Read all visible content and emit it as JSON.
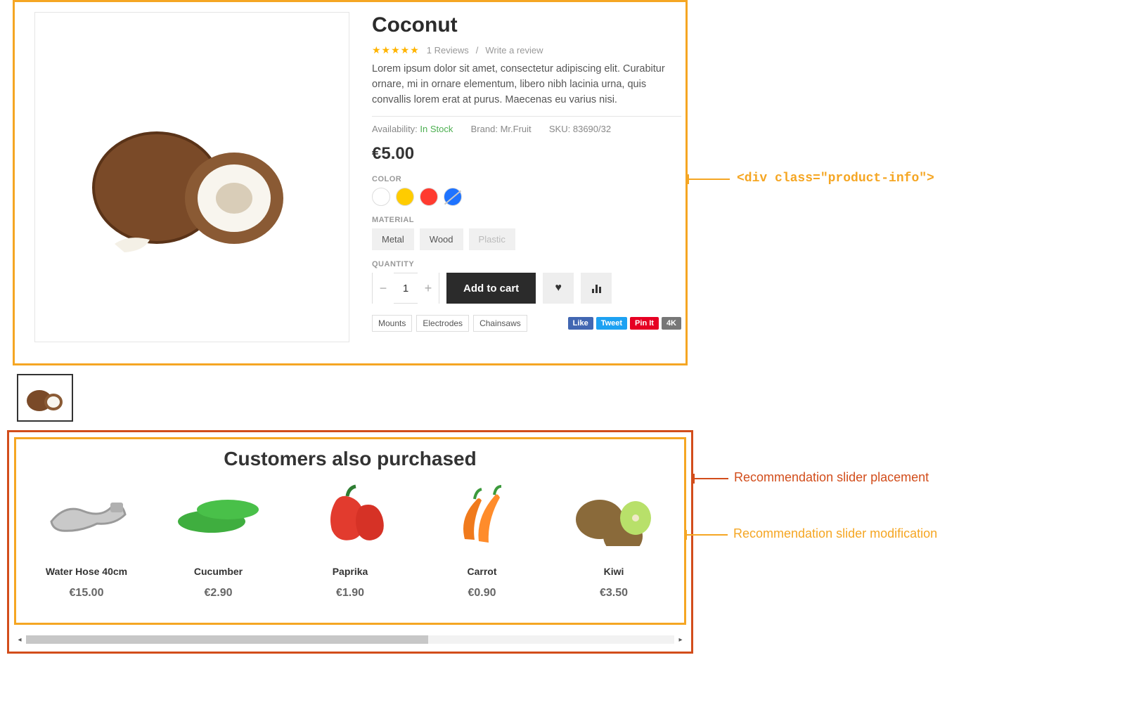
{
  "product": {
    "title": "Coconut",
    "reviews_count": "1 Reviews",
    "write_review": "Write a review",
    "description": "Lorem ipsum dolor sit amet, consectetur adipiscing elit. Curabitur ornare, mi in ornare elementum, libero nibh lacinia urna, quis convallis lorem erat at purus. Maecenas eu varius nisi.",
    "availability_label": "Availability:",
    "availability_value": "In Stock",
    "brand_label": "Brand:",
    "brand_value": "Mr.Fruit",
    "sku_label": "SKU:",
    "sku_value": "83690/32",
    "price": "€5.00",
    "color_label": "COLOR",
    "colors": [
      {
        "hex": "#ffffff",
        "disabled": false
      },
      {
        "hex": "#ffcc00",
        "disabled": false
      },
      {
        "hex": "#ff3b30",
        "disabled": false
      },
      {
        "hex": "#1e73ff",
        "disabled": true
      }
    ],
    "material_label": "MATERIAL",
    "materials": [
      {
        "label": "Metal",
        "disabled": false
      },
      {
        "label": "Wood",
        "disabled": false
      },
      {
        "label": "Plastic",
        "disabled": true
      }
    ],
    "quantity_label": "QUANTITY",
    "quantity_value": "1",
    "add_to_cart": "Add to cart",
    "tags": [
      "Mounts",
      "Electrodes",
      "Chainsaws"
    ],
    "social": {
      "like": "Like",
      "tweet": "Tweet",
      "pin": "Pin It",
      "count": "4K"
    }
  },
  "annotations": {
    "product_info": "<div class=\"product-info\">",
    "slider_placement": "Recommendation slider placement",
    "slider_modification": "Recommendation slider modification"
  },
  "recommendations": {
    "title": "Customers also purchased",
    "items": [
      {
        "name": "Water Hose 40cm",
        "price": "€15.00"
      },
      {
        "name": "Cucumber",
        "price": "€2.90"
      },
      {
        "name": "Paprika",
        "price": "€1.90"
      },
      {
        "name": "Carrot",
        "price": "€0.90"
      },
      {
        "name": "Kiwi",
        "price": "€3.50"
      }
    ]
  }
}
